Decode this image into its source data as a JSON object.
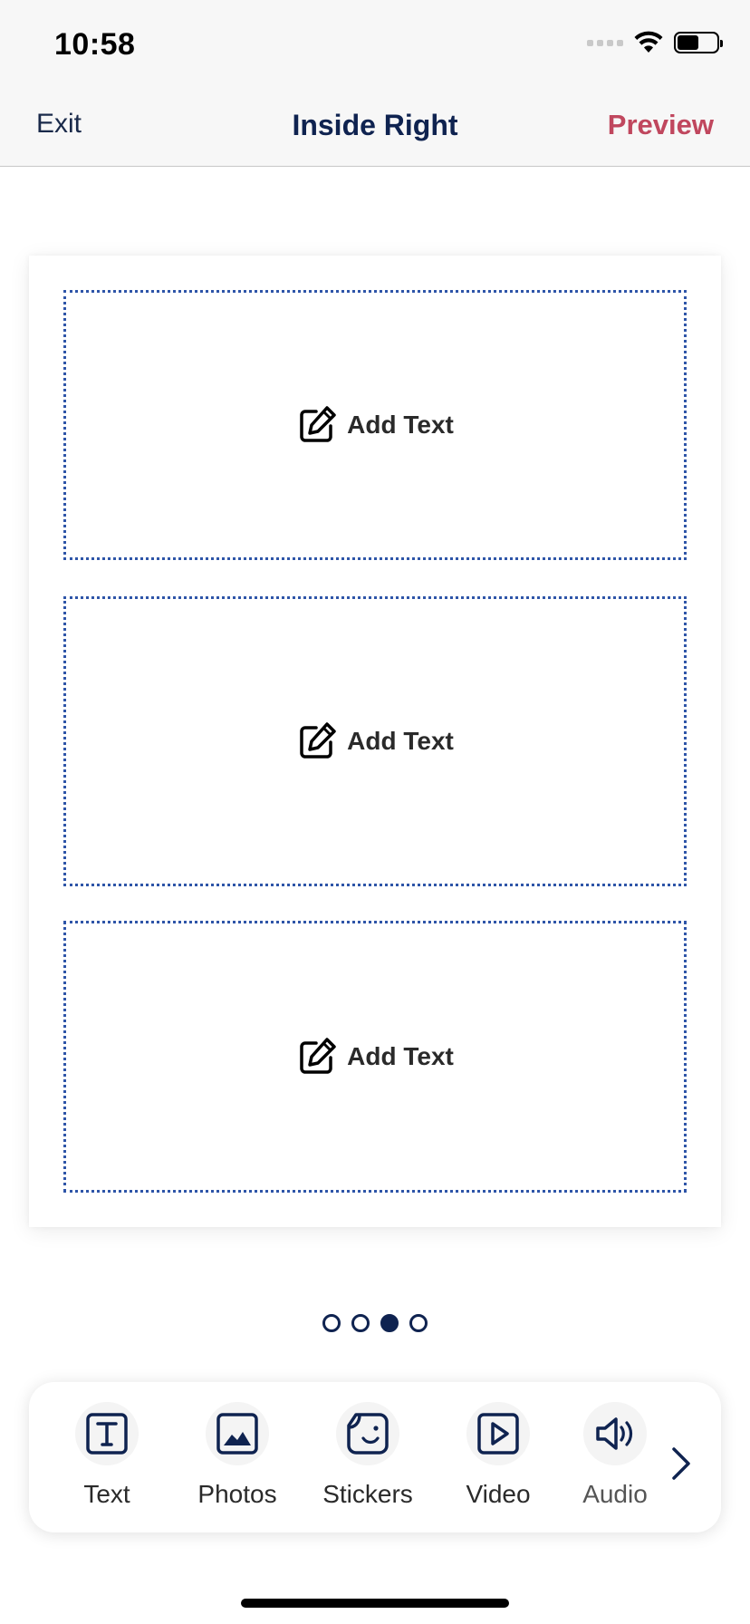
{
  "status_bar": {
    "time": "10:58",
    "signal_icon": "cellular-signal-icon",
    "wifi_icon": "wifi-icon",
    "battery_icon": "battery-icon",
    "battery_level": 0.55
  },
  "nav": {
    "exit_label": "Exit",
    "title": "Inside Right",
    "preview_label": "Preview",
    "preview_color": "#c0475e",
    "title_color": "#0f2350"
  },
  "card": {
    "slots": [
      {
        "label": "Add Text",
        "icon": "edit-icon"
      },
      {
        "label": "Add Text",
        "icon": "edit-icon"
      },
      {
        "label": "Add Text",
        "icon": "edit-icon"
      }
    ],
    "slot_border_color": "#2e55a8"
  },
  "pagination": {
    "total": 4,
    "active_index": 2
  },
  "toolbar": {
    "items": [
      {
        "label": "Text",
        "icon": "text-icon"
      },
      {
        "label": "Photos",
        "icon": "photo-icon"
      },
      {
        "label": "Stickers",
        "icon": "sticker-icon"
      },
      {
        "label": "Video",
        "icon": "video-play-icon"
      },
      {
        "label": "Audio",
        "icon": "speaker-icon"
      }
    ],
    "more_icon": "chevron-right-icon"
  }
}
